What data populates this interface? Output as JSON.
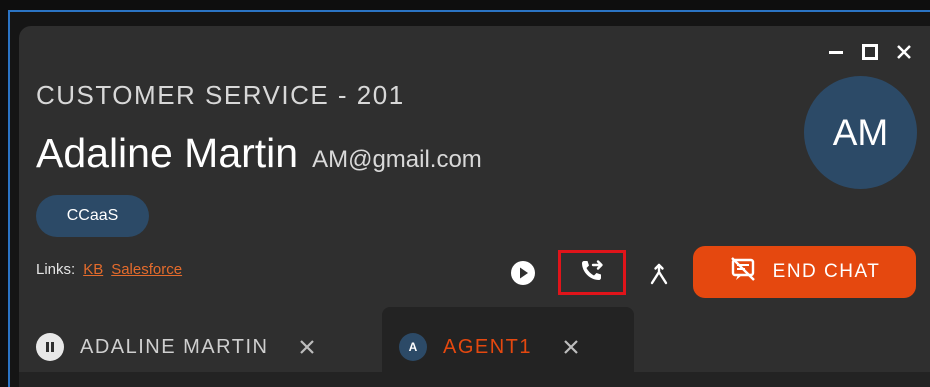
{
  "window": {
    "controls": {
      "minimize_icon": "minimize-icon",
      "maximize_icon": "maximize-icon",
      "close_icon": "close-icon"
    }
  },
  "header": {
    "queue": "CUSTOMER SERVICE - 201",
    "customer_name": "Adaline Martin",
    "email": "AM@gmail.com",
    "avatar_initials": "AM",
    "tag": "CCaaS"
  },
  "links": {
    "label": "Links:",
    "items": [
      "KB",
      "Salesforce"
    ]
  },
  "actions": {
    "play_icon": "play-icon",
    "transfer_icon": "phone-transfer-icon",
    "merge_icon": "merge-icon",
    "end_chat_label": "END CHAT",
    "end_chat_icon": "end-chat-icon"
  },
  "tabs": [
    {
      "label": "ADALINE MARTIN",
      "icon": "pause-icon"
    },
    {
      "label": "AGENT1",
      "avatar": "A"
    }
  ],
  "colors": {
    "accent": "#e5480f",
    "avatar_bg": "#2c4a67",
    "panel_bg": "#2f2f2f",
    "highlight_border": "#e0141a",
    "frame_border": "#2b74c4"
  }
}
